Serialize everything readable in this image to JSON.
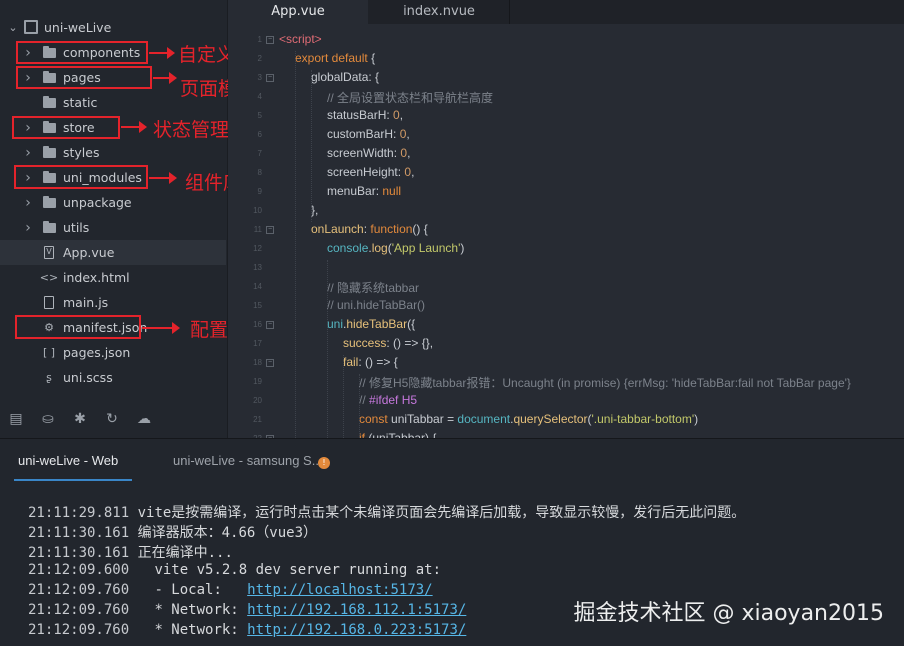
{
  "project": {
    "name": "uni-weLive"
  },
  "tree": [
    {
      "label": "components",
      "kind": "folder",
      "expandable": true,
      "icon": "folder-icon"
    },
    {
      "label": "pages",
      "kind": "folder",
      "expandable": true,
      "icon": "folder-icon"
    },
    {
      "label": "static",
      "kind": "folder",
      "expandable": false,
      "icon": "folder-icon"
    },
    {
      "label": "store",
      "kind": "folder",
      "expandable": true,
      "icon": "folder-icon"
    },
    {
      "label": "styles",
      "kind": "folder",
      "expandable": true,
      "icon": "folder-icon"
    },
    {
      "label": "uni_modules",
      "kind": "folder",
      "expandable": true,
      "icon": "folder-icon"
    },
    {
      "label": "unpackage",
      "kind": "folder",
      "expandable": true,
      "icon": "folder-icon"
    },
    {
      "label": "utils",
      "kind": "folder",
      "expandable": true,
      "icon": "folder-icon"
    },
    {
      "label": "App.vue",
      "kind": "file",
      "icon": "vue-file-icon",
      "glyph": "V"
    },
    {
      "label": "index.html",
      "kind": "file",
      "icon": "html-file-icon",
      "glyph": "<>"
    },
    {
      "label": "main.js",
      "kind": "file",
      "icon": "js-file-icon",
      "glyph": ""
    },
    {
      "label": "manifest.json",
      "kind": "file",
      "icon": "gear-file-icon",
      "glyph": "⚙"
    },
    {
      "label": "pages.json",
      "kind": "file",
      "icon": "json-file-icon",
      "glyph": "[ ]"
    },
    {
      "label": "uni.scss",
      "kind": "file",
      "icon": "scss-file-icon",
      "glyph": "ʂ"
    }
  ],
  "annotations": {
    "components": "自定义组件",
    "pages": "页面模板",
    "store": "状态管理",
    "uni_modules": "组件库",
    "manifest": "配置文件"
  },
  "sidebar_toolbar": [
    "file-tree-icon",
    "plugin-icon",
    "debug-icon",
    "git-icon",
    "cloud-icon"
  ],
  "editor_tabs": [
    {
      "label": "App.vue",
      "active": true
    },
    {
      "label": "index.nvue",
      "active": false
    }
  ],
  "code": {
    "line_numbers": [
      "1",
      "2",
      "3",
      "4",
      "5",
      "6",
      "7",
      "8",
      "9",
      "10",
      "11",
      "12",
      "13",
      "14",
      "15",
      "16",
      "17",
      "18",
      "19",
      "20",
      "21",
      "22"
    ],
    "lines": [
      [
        [
          "tk-tag",
          "<script>"
        ]
      ],
      [
        [
          "tk-kw",
          "export default "
        ],
        [
          "tk-punc",
          "{"
        ]
      ],
      [
        [
          "tk-prop",
          "globalData"
        ],
        [
          "tk-punc",
          ": {"
        ]
      ],
      [
        [
          "tk-com",
          "// 全局设置状态栏和导航栏高度"
        ]
      ],
      [
        [
          "tk-prop",
          "statusBarH"
        ],
        [
          "tk-punc",
          ": "
        ],
        [
          "tk-num",
          "0"
        ],
        [
          "tk-punc",
          ","
        ]
      ],
      [
        [
          "tk-prop",
          "customBarH"
        ],
        [
          "tk-punc",
          ": "
        ],
        [
          "tk-num",
          "0"
        ],
        [
          "tk-punc",
          ","
        ]
      ],
      [
        [
          "tk-prop",
          "screenWidth"
        ],
        [
          "tk-punc",
          ": "
        ],
        [
          "tk-num",
          "0"
        ],
        [
          "tk-punc",
          ","
        ]
      ],
      [
        [
          "tk-prop",
          "screenHeight"
        ],
        [
          "tk-punc",
          ": "
        ],
        [
          "tk-num",
          "0"
        ],
        [
          "tk-punc",
          ","
        ]
      ],
      [
        [
          "tk-prop",
          "menuBar"
        ],
        [
          "tk-punc",
          ": "
        ],
        [
          "tk-kw",
          "null"
        ]
      ],
      [
        [
          "tk-punc",
          "},"
        ]
      ],
      [
        [
          "tk-fnname",
          "onLaunch"
        ],
        [
          "tk-punc",
          ": "
        ],
        [
          "tk-kw",
          "function"
        ],
        [
          "tk-punc",
          "() {"
        ]
      ],
      [
        [
          "tk-obj",
          "console"
        ],
        [
          "tk-punc",
          "."
        ],
        [
          "tk-fnname",
          "log"
        ],
        [
          "tk-punc",
          "("
        ],
        [
          "tk-str",
          "'App Launch'"
        ],
        [
          "tk-punc",
          ")"
        ]
      ],
      [],
      [
        [
          "tk-com",
          "// 隐藏系统tabbar"
        ]
      ],
      [
        [
          "tk-com",
          "// uni.hideTabBar()"
        ]
      ],
      [
        [
          "tk-obj",
          "uni"
        ],
        [
          "tk-punc",
          "."
        ],
        [
          "tk-fnname",
          "hideTabBar"
        ],
        [
          "tk-punc",
          "({"
        ]
      ],
      [
        [
          "tk-fnname",
          "success"
        ],
        [
          "tk-punc",
          ": () => {},"
        ]
      ],
      [
        [
          "tk-fnname",
          "fail"
        ],
        [
          "tk-punc",
          ": () => {"
        ]
      ],
      [
        [
          "tk-com",
          "// 修复H5隐藏tabbar报错：Uncaught (in promise) {errMsg: 'hideTabBar:fail not TabBar page'}"
        ]
      ],
      [
        [
          "tk-com",
          "// "
        ],
        [
          "tk-pp",
          "#ifdef H5"
        ]
      ],
      [
        [
          "tk-kw",
          "const "
        ],
        [
          "tk-prop",
          "uniTabbar "
        ],
        [
          "tk-punc",
          "= "
        ],
        [
          "tk-obj",
          "document"
        ],
        [
          "tk-punc",
          "."
        ],
        [
          "tk-fnname",
          "querySelector"
        ],
        [
          "tk-punc",
          "("
        ],
        [
          "tk-str",
          "'.uni-tabbar-bottom'"
        ],
        [
          "tk-punc",
          ")"
        ]
      ],
      [
        [
          "tk-kw",
          "if "
        ],
        [
          "tk-punc",
          "(uniTabbar) {"
        ]
      ]
    ]
  },
  "console_tabs": [
    {
      "label": "uni-weLive - Web",
      "active": true
    },
    {
      "label": "uni-weLive - samsung S...",
      "active": false,
      "badge": "!"
    }
  ],
  "console_lines": [
    {
      "time": "21:11:29.811",
      "text": "vite是按需编译，运行时点击某个未编译页面会先编译后加载，导致显示较慢，发行后无此问题。",
      "link": ""
    },
    {
      "time": "21:11:30.161",
      "text": "编译器版本：4.66（vue3）",
      "link": ""
    },
    {
      "time": "21:11:30.161",
      "text": "正在编译中...",
      "link": ""
    },
    {
      "time": "21:12:09.600",
      "text": "  vite v5.2.8 dev server running at:",
      "link": ""
    },
    {
      "time": "21:12:09.760",
      "text": "  - Local:   ",
      "link": "http://localhost:5173/"
    },
    {
      "time": "21:12:09.760",
      "text": "  * Network: ",
      "link": "http://192.168.112.1:5173/"
    },
    {
      "time": "21:12:09.760",
      "text": "  * Network: ",
      "link": "http://192.168.0.223:5173/"
    }
  ],
  "watermark": "掘金技术社区 @ xiaoyan2015"
}
